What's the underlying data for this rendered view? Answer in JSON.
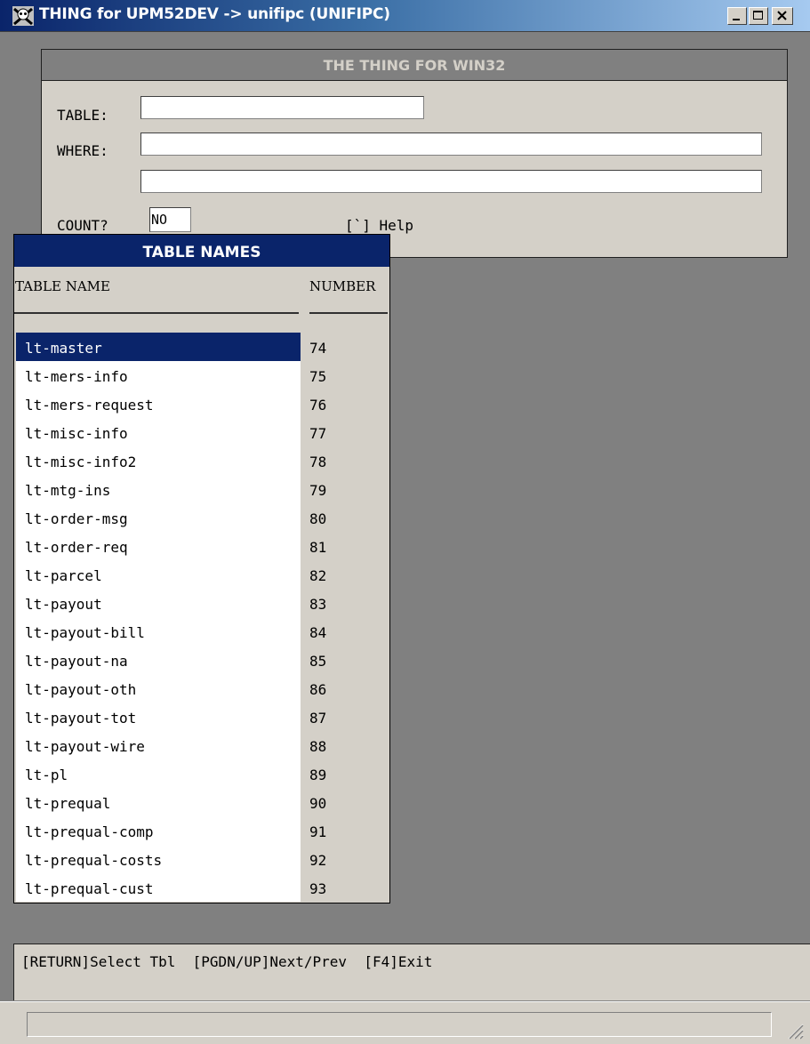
{
  "window": {
    "title": "THING for UPM52DEV -> unifipc (UNIFIPC)",
    "controls": {
      "minimize": "minimize-icon",
      "maximize": "maximize-icon",
      "close": "close-icon"
    }
  },
  "form": {
    "header": "THE THING FOR WIN32",
    "table_label": "TABLE:",
    "table_value": "",
    "where_label": "WHERE:",
    "where_value_1": "",
    "where_value_2": "",
    "count_label": "COUNT?",
    "count_value": "NO",
    "help_text": "[`] Help"
  },
  "table_names": {
    "header": "TABLE NAMES",
    "col_name": "TABLE NAME",
    "col_number": "NUMBER",
    "rows": [
      {
        "name": "lt-master",
        "number": "74",
        "selected": true
      },
      {
        "name": "lt-mers-info",
        "number": "75"
      },
      {
        "name": "lt-mers-request",
        "number": "76"
      },
      {
        "name": "lt-misc-info",
        "number": "77"
      },
      {
        "name": "lt-misc-info2",
        "number": "78"
      },
      {
        "name": "lt-mtg-ins",
        "number": "79"
      },
      {
        "name": "lt-order-msg",
        "number": "80"
      },
      {
        "name": "lt-order-req",
        "number": "81"
      },
      {
        "name": "lt-parcel",
        "number": "82"
      },
      {
        "name": "lt-payout",
        "number": "83"
      },
      {
        "name": "lt-payout-bill",
        "number": "84"
      },
      {
        "name": "lt-payout-na",
        "number": "85"
      },
      {
        "name": "lt-payout-oth",
        "number": "86"
      },
      {
        "name": "lt-payout-tot",
        "number": "87"
      },
      {
        "name": "lt-payout-wire",
        "number": "88"
      },
      {
        "name": "lt-pl",
        "number": "89"
      },
      {
        "name": "lt-prequal",
        "number": "90"
      },
      {
        "name": "lt-prequal-comp",
        "number": "91"
      },
      {
        "name": "lt-prequal-costs",
        "number": "92"
      },
      {
        "name": "lt-prequal-cust",
        "number": "93"
      }
    ]
  },
  "keybar": "[RETURN]Select Tbl  [PGDN/UP]Next/Prev  [F4]Exit",
  "colors": {
    "selection": "#0a246a",
    "face": "#d4d0c8",
    "background": "#808080"
  }
}
